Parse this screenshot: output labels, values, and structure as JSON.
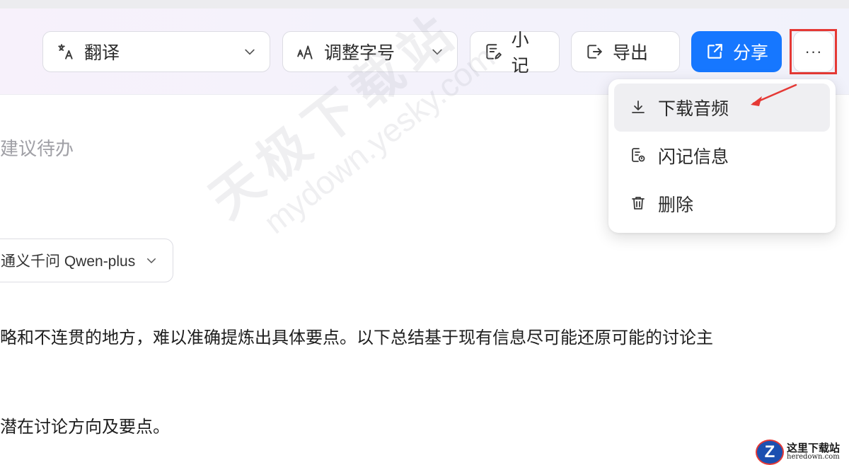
{
  "toolbar": {
    "translate": {
      "label": "翻译",
      "icon": "translate-icon"
    },
    "font_size": {
      "label": "调整字号",
      "icon": "font-size-icon"
    },
    "note": {
      "label": "小记",
      "icon": "note-icon"
    },
    "export": {
      "label": "导出",
      "icon": "export-icon"
    },
    "share": {
      "label": "分享",
      "icon": "share-icon"
    },
    "more": {
      "label": "···",
      "icon": "more-icon"
    }
  },
  "content": {
    "todo_label": "建议待办",
    "model_select": "通义千问 Qwen-plus",
    "paragraph_1": "略和不连贯的地方，难以准确提炼出具体要点。以下总结基于现有信息尽可能还原可能的讨论主",
    "paragraph_2": "潜在讨论方向及要点。"
  },
  "dropdown_menu": {
    "items": [
      {
        "label": "下载音频",
        "icon": "download-icon",
        "active": true
      },
      {
        "label": "闪记信息",
        "icon": "info-doc-icon",
        "active": false
      },
      {
        "label": "删除",
        "icon": "trash-icon",
        "active": false
      }
    ]
  },
  "watermark": {
    "cn": "天极下载站",
    "en": "mydown.yesky.com"
  },
  "corner_logo": {
    "letter": "Z",
    "cn": "这里下载站",
    "en": "heredown.com"
  },
  "colors": {
    "primary": "#1677ff",
    "highlight": "#e53935"
  }
}
